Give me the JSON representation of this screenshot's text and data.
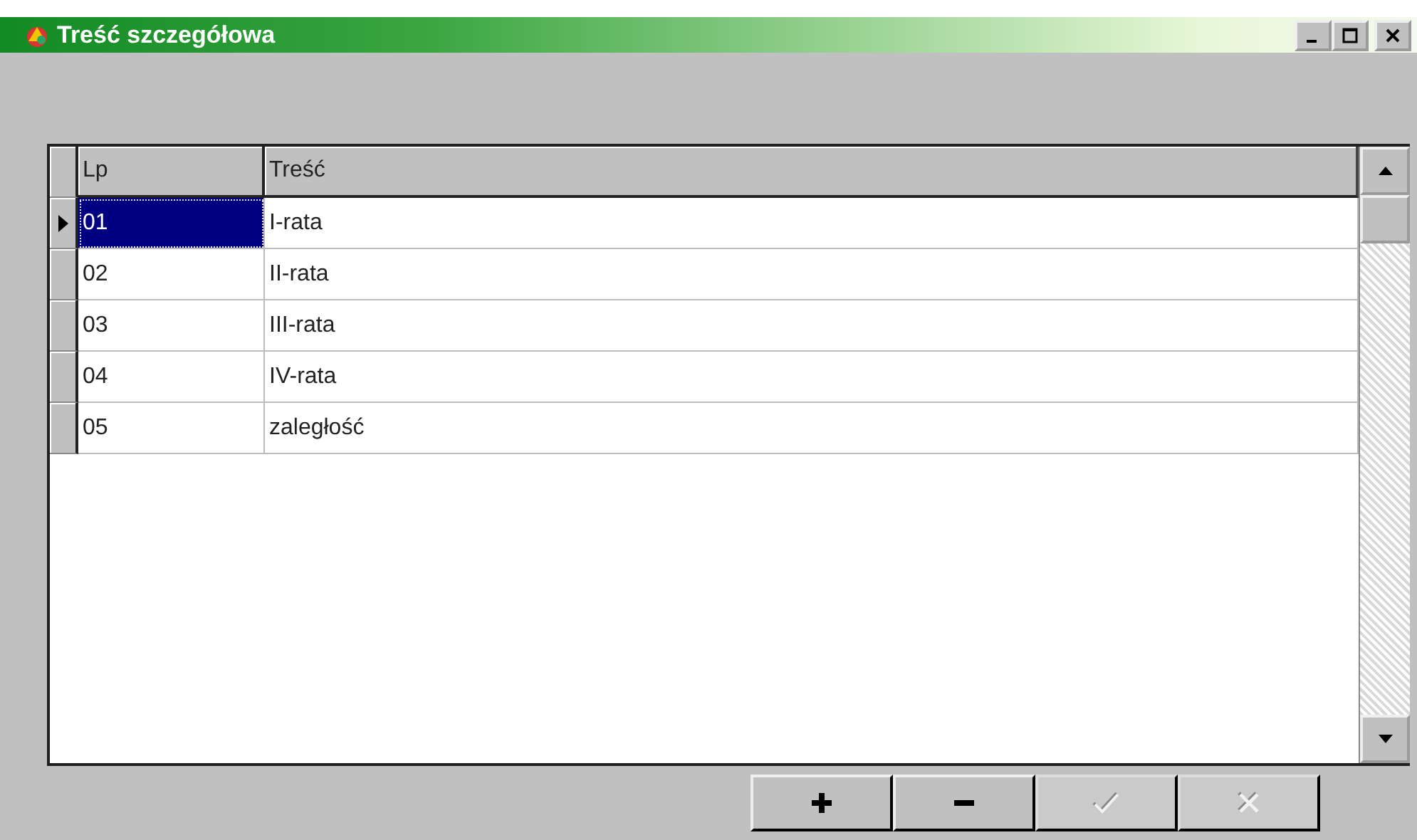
{
  "window": {
    "title": "Treść szczegółowa",
    "controls": [
      {
        "kind": "minimize"
      },
      {
        "kind": "maximize"
      },
      {
        "kind": "close"
      }
    ]
  },
  "table": {
    "columns": [
      "Lp",
      "Treść"
    ],
    "rows": [
      {
        "cells": [
          "01",
          "I-rata"
        ],
        "selected": true
      },
      {
        "cells": [
          "02",
          "II-rata"
        ],
        "selected": false
      },
      {
        "cells": [
          "03",
          "III-rata"
        ],
        "selected": false
      },
      {
        "cells": [
          "04",
          "IV-rata"
        ],
        "selected": false
      },
      {
        "cells": [
          "05",
          "zaległość"
        ],
        "selected": false
      }
    ]
  },
  "buttons": [
    {
      "kind": "add",
      "disabled": false
    },
    {
      "kind": "remove",
      "disabled": false
    },
    {
      "kind": "confirm",
      "disabled": true
    },
    {
      "kind": "cancel",
      "disabled": true
    }
  ]
}
